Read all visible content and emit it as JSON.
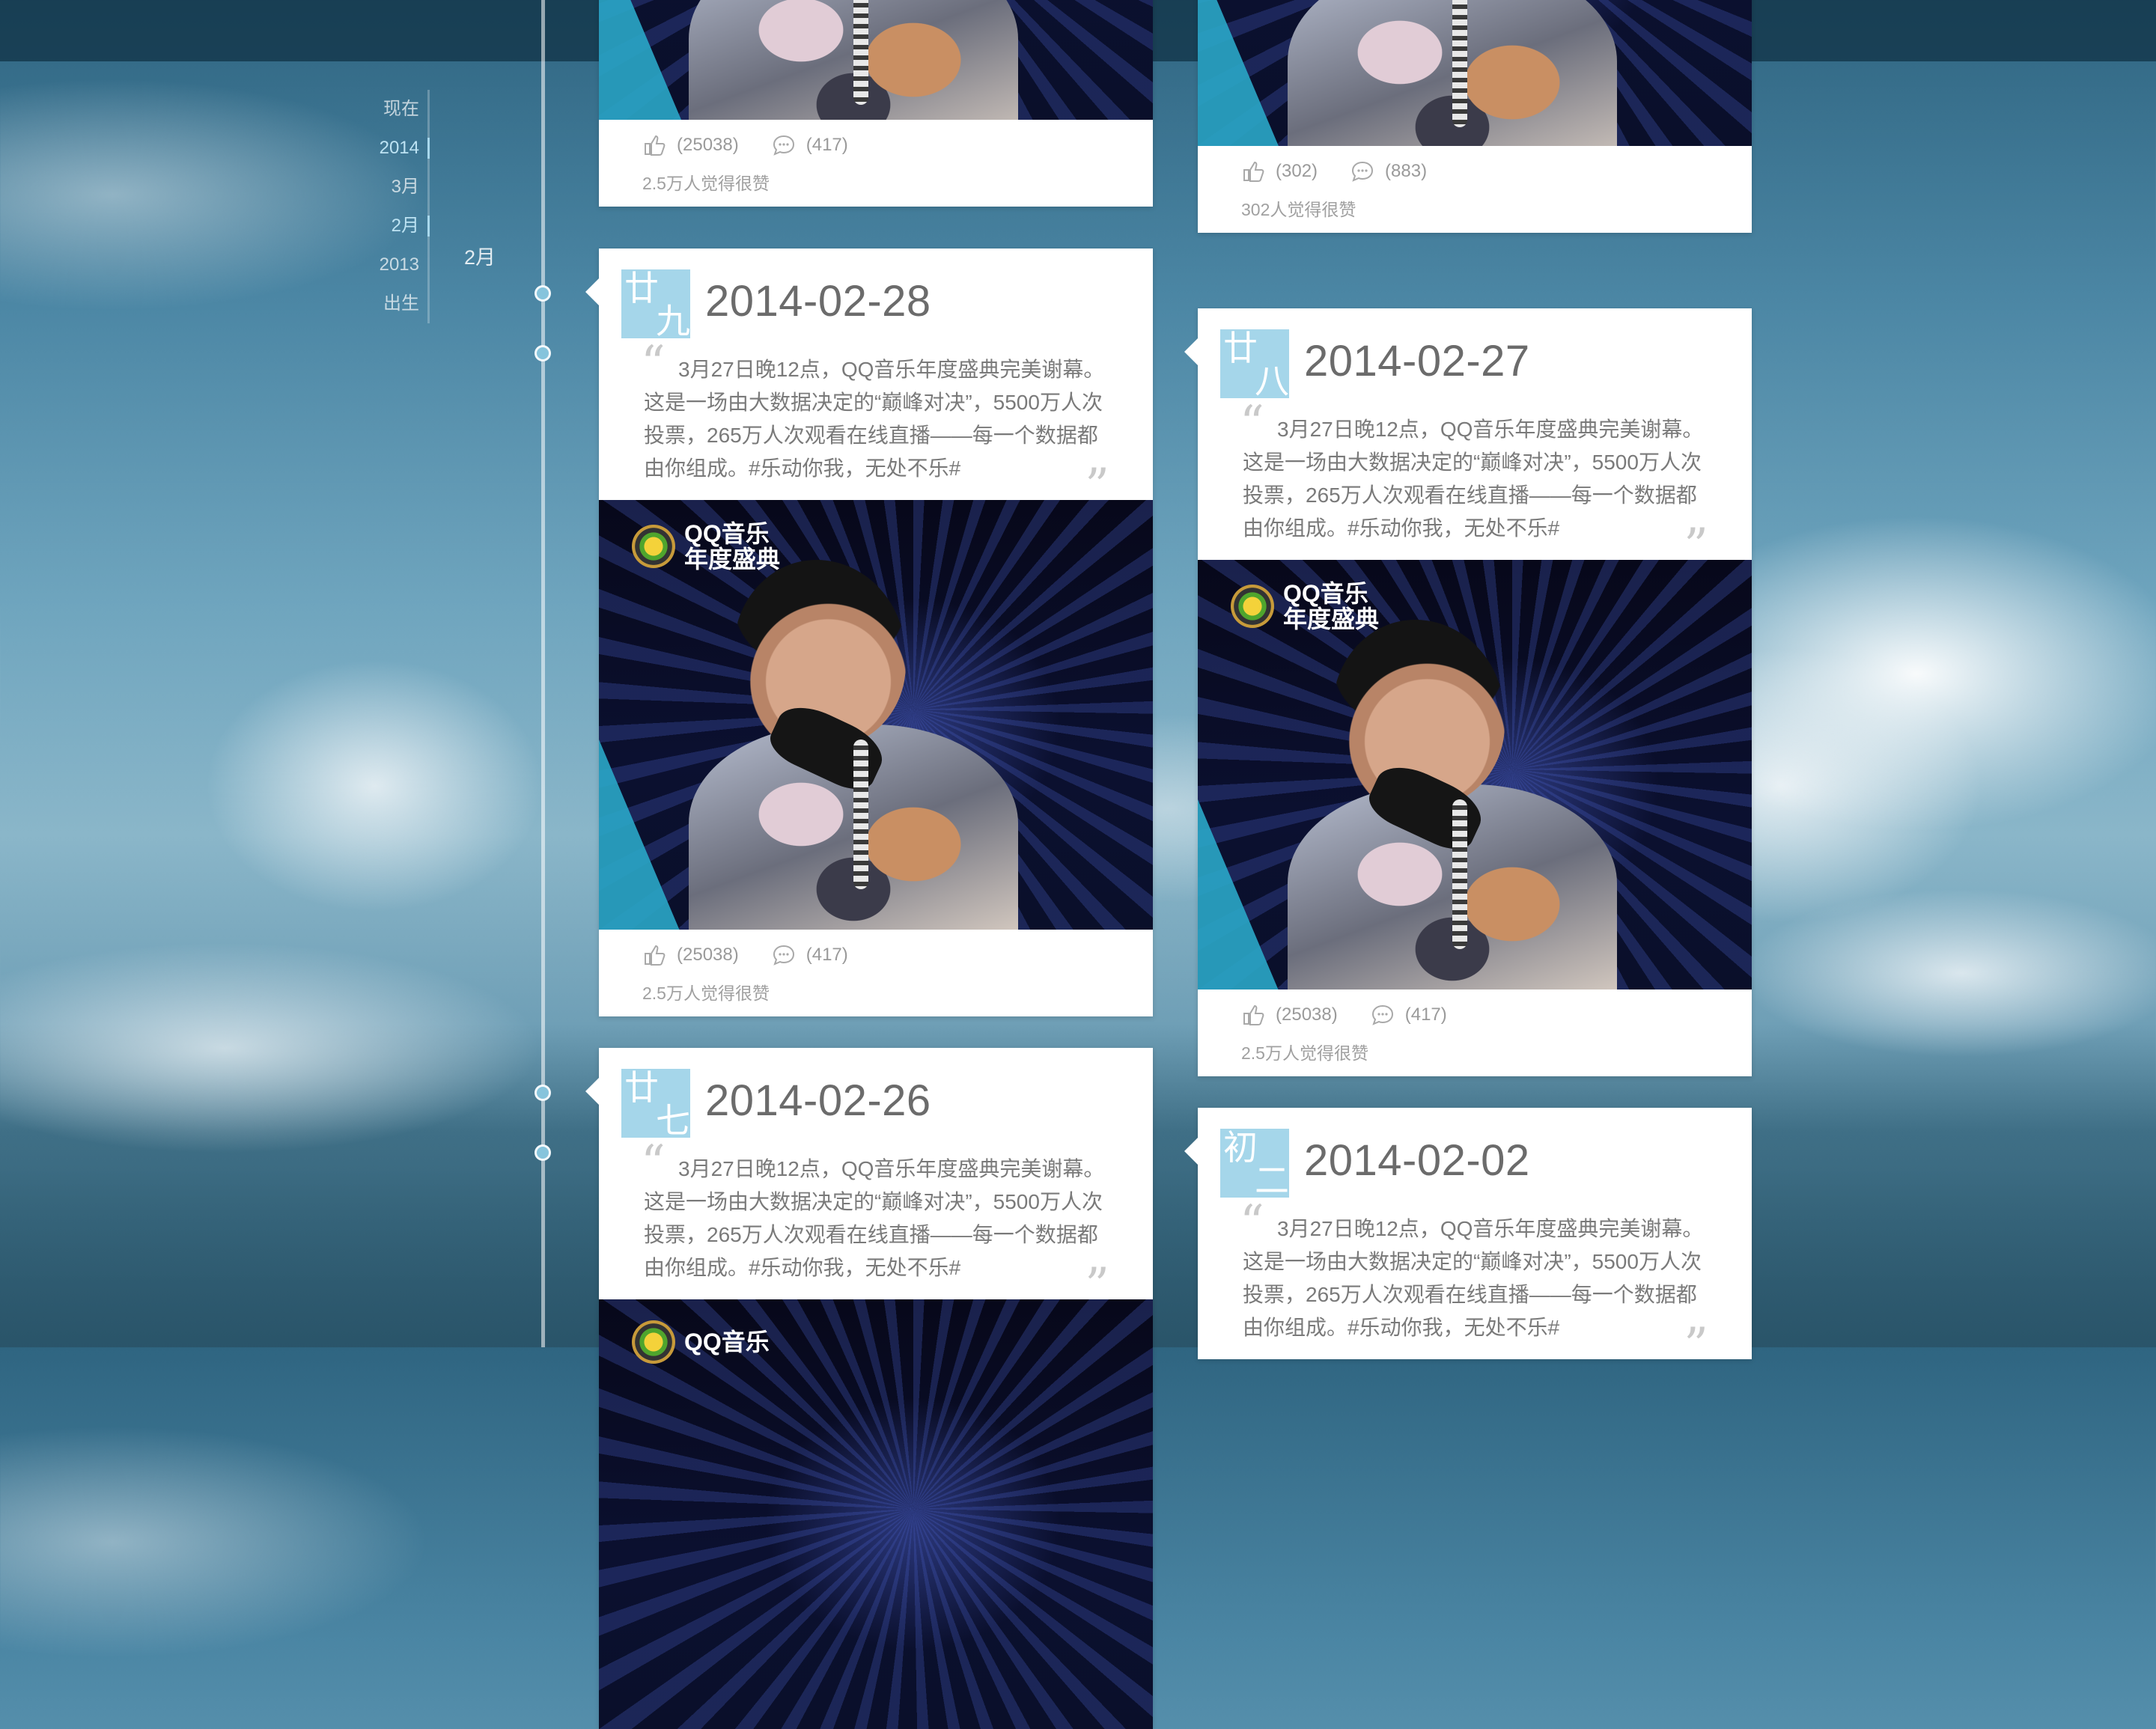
{
  "nav": {
    "items": [
      {
        "label": "现在",
        "active": false
      },
      {
        "label": "2014",
        "active": true
      },
      {
        "label": "3月",
        "active": false
      },
      {
        "label": "2月",
        "active": true
      },
      {
        "label": "2013",
        "active": false
      },
      {
        "label": "出生",
        "active": false
      }
    ],
    "sub_month": "2月"
  },
  "top_left_card": {
    "likes": "(25038)",
    "comments": "(417)",
    "like_text": "2.5万人觉得很赞"
  },
  "top_right_card": {
    "likes": "(302)",
    "comments": "(883)",
    "like_text": "302人觉得很赞"
  },
  "cards": [
    {
      "lunar_1": "廿",
      "lunar_2": "九",
      "date": "2014-02-28",
      "text": "3月27日晚12点，QQ音乐年度盛典完美谢幕。这是一场由大数据决定的“巅峰对决”，5500万人次投票，265万人次观看在线直播——每一个数据都由你组成。#乐动你我，无处不乐#",
      "likes": "(25038)",
      "comments": "(417)",
      "like_text": "2.5万人觉得很赞"
    },
    {
      "lunar_1": "廿",
      "lunar_2": "八",
      "date": "2014-02-27",
      "text": "3月27日晚12点，QQ音乐年度盛典完美谢幕。这是一场由大数据决定的“巅峰对决”，5500万人次投票，265万人次观看在线直播——每一个数据都由你组成。#乐动你我，无处不乐#",
      "likes": "(25038)",
      "comments": "(417)",
      "like_text": "2.5万人觉得很赞"
    },
    {
      "lunar_1": "廿",
      "lunar_2": "七",
      "date": "2014-02-26",
      "text": "3月27日晚12点，QQ音乐年度盛典完美谢幕。这是一场由大数据决定的“巅峰对决”，5500万人次投票，265万人次观看在线直播——每一个数据都由你组成。#乐动你我，无处不乐#"
    },
    {
      "lunar_1": "初",
      "lunar_2": "二",
      "date": "2014-02-02",
      "text": "3月27日晚12点，QQ音乐年度盛典完美谢幕。这是一场由大数据决定的“巅峰对决”，5500万人次投票，265万人次观看在线直播——每一个数据都由你组成。#乐动你我，无处不乐#"
    }
  ],
  "photo": {
    "logo_line1": "QQ音乐",
    "logo_line2": "年度盛典"
  },
  "colors": {
    "accent": "#a5d6ea",
    "timeline_dot": "#86c4dc",
    "card_bg": "#ffffff"
  }
}
